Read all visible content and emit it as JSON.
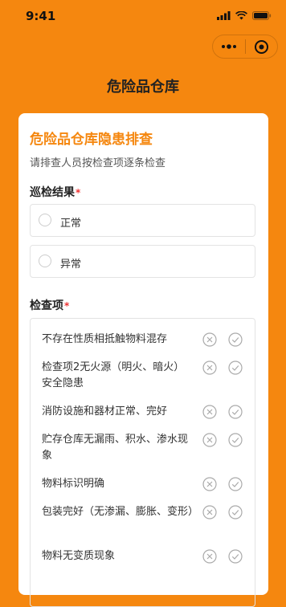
{
  "status_bar": {
    "time": "9:41"
  },
  "nav": {
    "title": "危险品仓库"
  },
  "card": {
    "title": "危险品仓库隐患排查",
    "subtitle": "请排查人员按检查项逐条检查",
    "result_section": {
      "label": "巡检结果",
      "required_mark": "*"
    },
    "options": [
      {
        "label": "正常"
      },
      {
        "label": "异常"
      }
    ],
    "items_section": {
      "label": "检查项",
      "required_mark": "*"
    },
    "items": [
      {
        "text": "不存在性质相抵触物料混存"
      },
      {
        "text": "检查项2无火源（明火、暗火）安全隐患"
      },
      {
        "text": "消防设施和器材正常、完好"
      },
      {
        "text": "贮存仓库无漏雨、积水、渗水现象"
      },
      {
        "text": "物料标识明确"
      },
      {
        "text": "包装完好（无渗漏、膨胀、变形）"
      },
      {
        "text": "物料无变质现象"
      }
    ]
  },
  "colors": {
    "accent": "#f5870f",
    "required": "#ee3333"
  },
  "icons": [
    "signal-icon",
    "wifi-icon",
    "battery-icon",
    "more-dots-icon",
    "close-circle-icon",
    "reject-icon",
    "approve-icon"
  ]
}
